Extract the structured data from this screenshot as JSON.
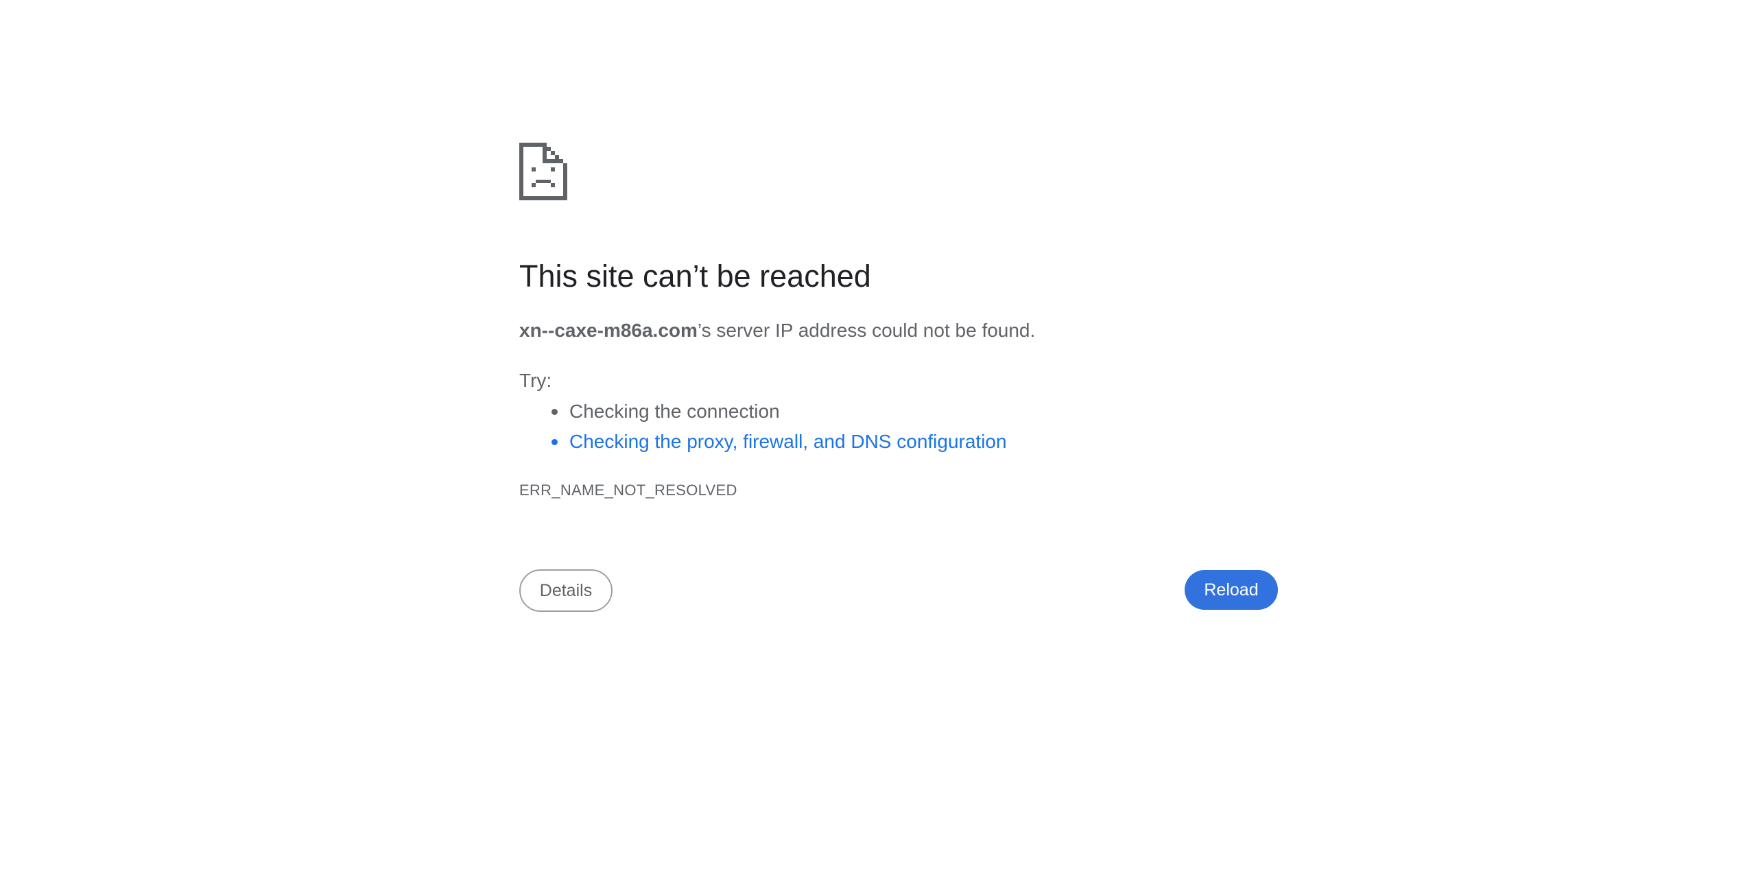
{
  "page": {
    "icon": "sad-page-icon",
    "title": "This site can’t be reached",
    "summary": {
      "host": "xn--caxe-m86a.com",
      "message": "’s server IP address could not be found."
    },
    "try_label": "Try:",
    "suggestions": [
      {
        "text": "Checking the connection",
        "is_link": false
      },
      {
        "text": "Checking the proxy, firewall, and DNS configuration",
        "is_link": true
      }
    ],
    "error_code": "ERR_NAME_NOT_RESOLVED",
    "buttons": {
      "details": "Details",
      "reload": "Reload"
    }
  },
  "colors": {
    "text_primary": "#202124",
    "text_secondary": "#5f6368",
    "link": "#1a73e8",
    "reload_button": "#3272de",
    "icon": "#5f6368"
  }
}
